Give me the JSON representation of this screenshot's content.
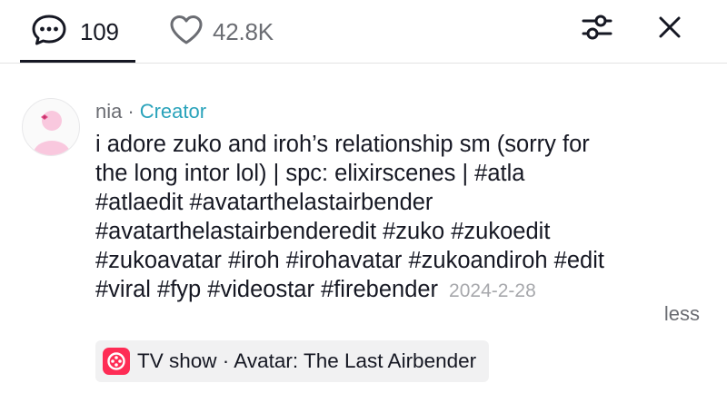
{
  "header": {
    "comments_count": "109",
    "likes_count": "42.8K",
    "icons": {
      "comments": "speech-bubble-icon",
      "likes": "heart-outline-icon",
      "filter": "sliders-icon",
      "close": "close-icon"
    }
  },
  "comment": {
    "username": "nia",
    "separator": "·",
    "badge": "Creator",
    "lines": [
      "i adore zuko and iroh’s relationship sm (sorry for",
      "the long intor lol)  | spc: elixirscenes | #atla",
      "#atlaedit #avatarthelastairbender",
      "#avatarthelastairbenderedit #zuko #zukoedit",
      "#zukoavatar #iroh #irohavatar #zukoandiroh #edit",
      "#viral #fyp #videostar #firebender"
    ],
    "date": "2024-2-28",
    "less_label": "less"
  },
  "anchor": {
    "label": "TV show · Avatar: The Last Airbender",
    "icon": "film-reel-icon",
    "icon_color": "#fe2c55"
  },
  "colors": {
    "badge": "#2aa3bb",
    "text": "#161823",
    "muted": "#6b6d73",
    "date": "#a7a8ac"
  }
}
